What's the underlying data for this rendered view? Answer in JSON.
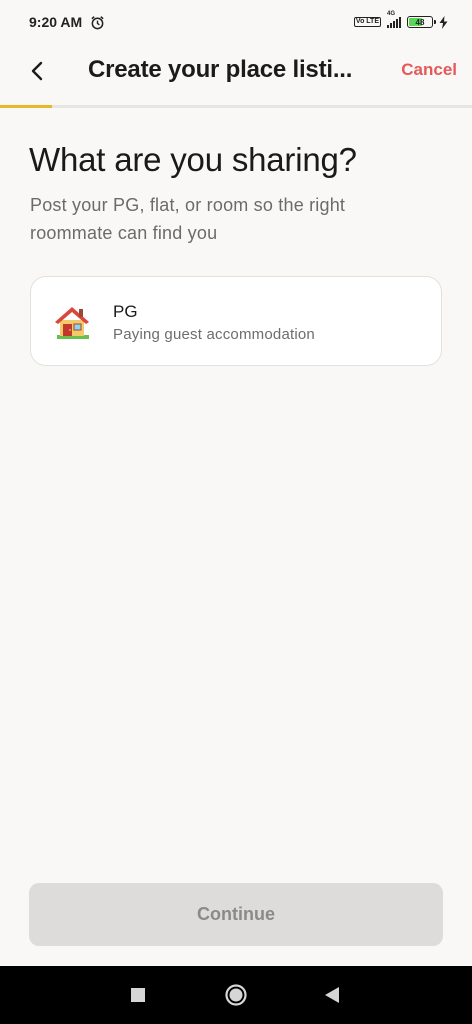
{
  "status_bar": {
    "time": "9:20 AM",
    "alarm_icon": "alarm-clock-icon",
    "volte": "Vo LTE",
    "network": "4G",
    "battery_level": "48",
    "charging_icon": "lightning-icon"
  },
  "header": {
    "back_icon": "chevron-left-icon",
    "title": "Create your place listi...",
    "cancel_label": "Cancel"
  },
  "progress": {
    "value": 0.11,
    "color": "#e7b927"
  },
  "main": {
    "heading": "What are you sharing?",
    "subheading": "Post your PG, flat, or room so the right roommate can find you",
    "options": [
      {
        "icon": "house-icon",
        "title": "PG",
        "description": "Paying guest accommodation"
      }
    ]
  },
  "footer": {
    "continue_label": "Continue"
  },
  "android_nav": {
    "recents_icon": "square-icon",
    "home_icon": "circle-icon",
    "back_icon": "triangle-back-icon"
  },
  "colors": {
    "accent": "#e7b927",
    "cancel": "#e45a5a",
    "background": "#f9f8f6"
  }
}
